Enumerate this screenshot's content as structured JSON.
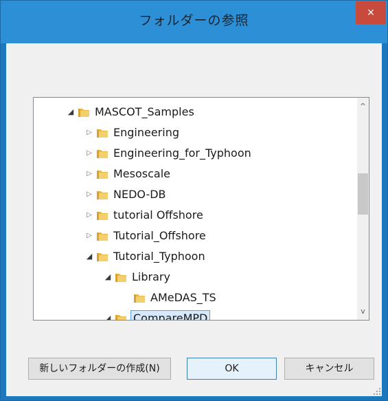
{
  "window": {
    "title": "フォルダーの参照",
    "close_label": "×"
  },
  "tree": {
    "items": [
      {
        "label": "MASCOT_Samples",
        "state": "expanded",
        "level": 0
      },
      {
        "label": "Engineering",
        "state": "collapsed",
        "level": 1
      },
      {
        "label": "Engineering_for_Typhoon",
        "state": "collapsed",
        "level": 1
      },
      {
        "label": "Mesoscale",
        "state": "collapsed",
        "level": 1
      },
      {
        "label": "NEDO-DB",
        "state": "collapsed",
        "level": 1
      },
      {
        "label": "tutorial Offshore",
        "state": "collapsed",
        "level": 1
      },
      {
        "label": "Tutorial_Offshore",
        "state": "collapsed",
        "level": 1
      },
      {
        "label": "Tutorial_Typhoon",
        "state": "expanded",
        "level": 1
      },
      {
        "label": "Library",
        "state": "expanded",
        "level": 2
      },
      {
        "label": "AMeDAS_TS",
        "state": "none",
        "level": 3
      },
      {
        "label": "CompareMPD",
        "state": "expanded",
        "level": 2,
        "selected": true
      }
    ],
    "arrow_icons": {
      "expanded": "◢",
      "collapsed": "▷"
    }
  },
  "scrollbar": {
    "up_icon": "^",
    "down_icon": "v"
  },
  "buttons": {
    "new_folder": "新しいフォルダーの作成(N)",
    "ok": "OK",
    "cancel": "キャンセル"
  },
  "colors": {
    "titlebar": "#2d8fd6",
    "close": "#c74a3c",
    "selection": "#d6e9fb"
  }
}
